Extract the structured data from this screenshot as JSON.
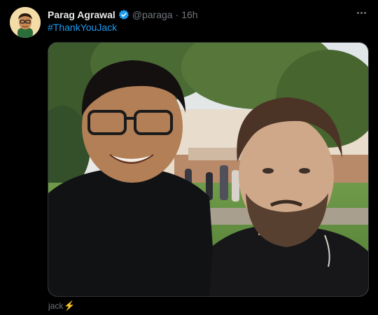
{
  "tweet": {
    "author": {
      "display_name": "Parag Agrawal",
      "verified": true,
      "handle": "@paraga",
      "separator": "·",
      "timestamp": "16h",
      "avatar_icon": "memoji-avatar-icon"
    },
    "text": {
      "hashtag": "#ThankYouJack"
    },
    "media": {
      "kind": "photo",
      "tag_user": "jack",
      "tag_emoji": "⚡"
    },
    "more_icon": "more-options-icon"
  },
  "colors": {
    "background": "#000000",
    "text_primary": "#e7e9ea",
    "text_secondary": "#71767b",
    "link": "#1d9bf0",
    "verified": "#1d9bf0"
  }
}
